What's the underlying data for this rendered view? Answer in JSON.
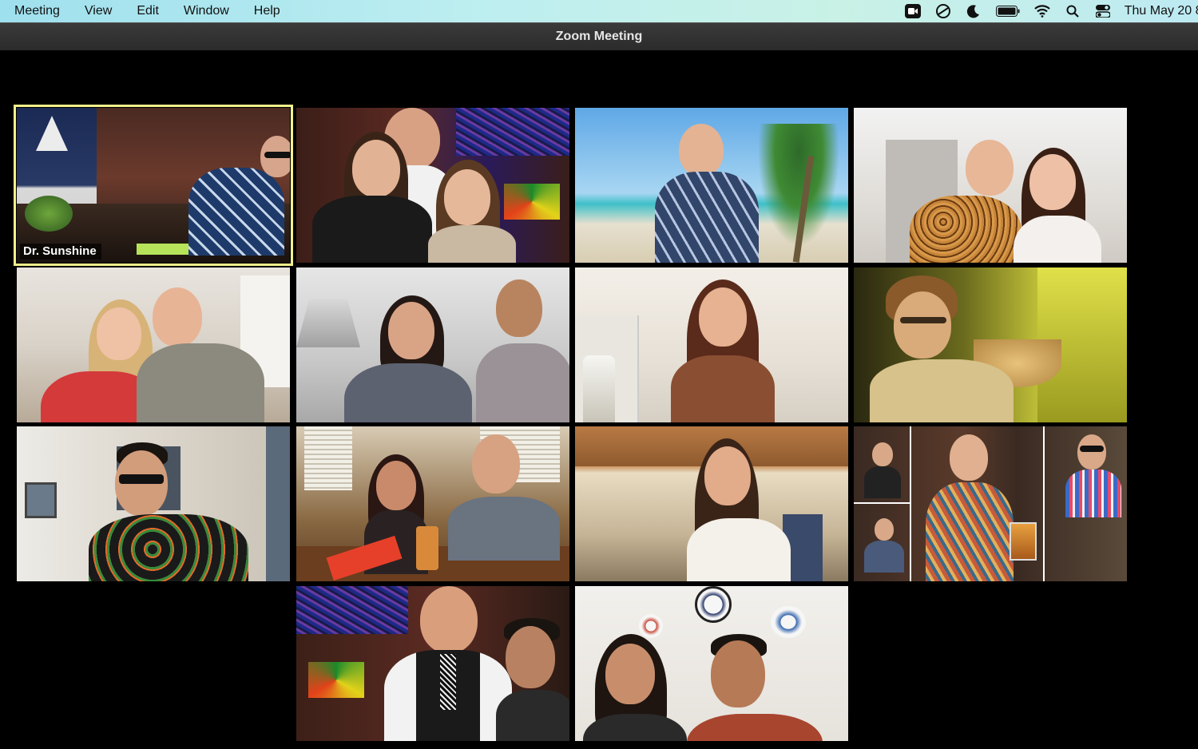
{
  "menubar": {
    "items": [
      "Meeting",
      "View",
      "Edit",
      "Window",
      "Help"
    ],
    "status_icons": [
      "zoom-camera-icon",
      "focus-icon",
      "moon-icon",
      "battery-icon",
      "wifi-icon",
      "search-icon",
      "control-center-icon"
    ],
    "clock": "Thu May 20  8:"
  },
  "window": {
    "title": "Zoom Meeting"
  },
  "gallery": {
    "active_speaker": "Dr. Sunshine",
    "tiles": [
      {
        "id": "tile-1",
        "label": "Dr. Sunshine"
      },
      {
        "id": "tile-2"
      },
      {
        "id": "tile-3"
      },
      {
        "id": "tile-4"
      },
      {
        "id": "tile-5"
      },
      {
        "id": "tile-6"
      },
      {
        "id": "tile-7"
      },
      {
        "id": "tile-8"
      },
      {
        "id": "tile-9"
      },
      {
        "id": "tile-10"
      },
      {
        "id": "tile-11"
      },
      {
        "id": "tile-12"
      },
      {
        "id": "tile-13"
      },
      {
        "id": "tile-14"
      }
    ]
  },
  "colors": {
    "active_border": "#f3f08a",
    "menubar": "#bdeef0",
    "titlebar": "#2f2f2f"
  }
}
